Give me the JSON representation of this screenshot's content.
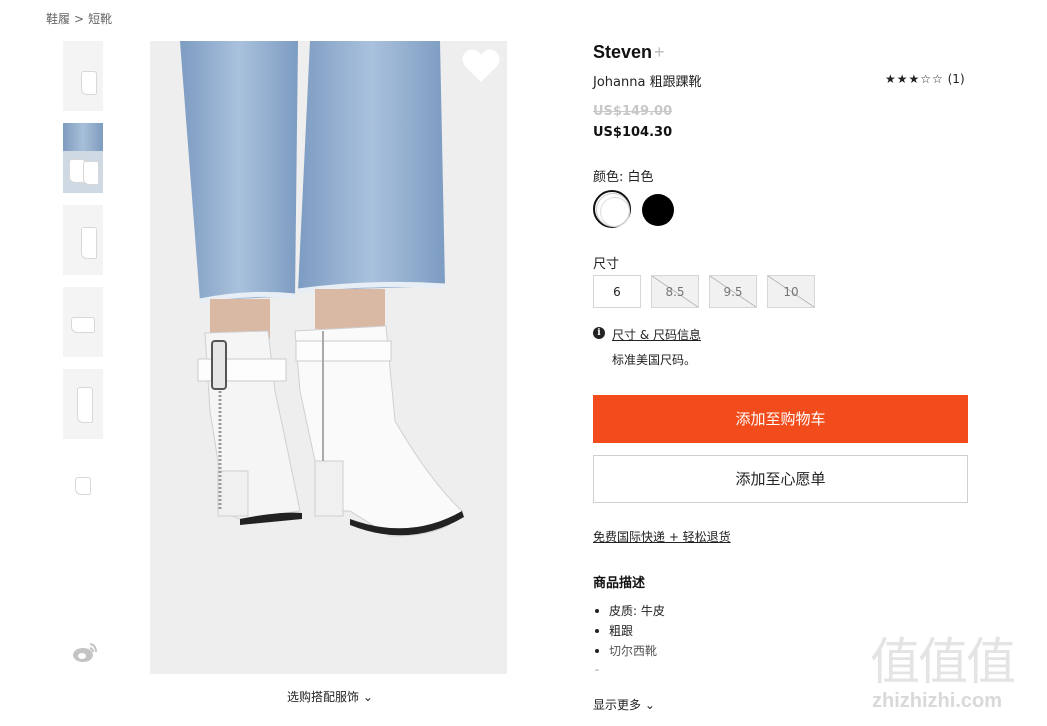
{
  "breadcrumb": {
    "level1": "鞋履",
    "sep": ">",
    "level2": "短靴"
  },
  "gallery": {
    "thumbnails": [
      "thumb-1",
      "thumb-2",
      "thumb-3",
      "thumb-4",
      "thumb-5",
      "thumb-6"
    ],
    "selected_index": 1
  },
  "main_image": {
    "match_link": "选购搭配服饰"
  },
  "product": {
    "brand": "Steven",
    "brand_plus": "+",
    "name": "Johanna 粗跟踝靴",
    "rating_stars": "★★★☆☆",
    "rating_count": "(1)",
    "price_original": "US$149.00",
    "price_sale": "US$104.30"
  },
  "color": {
    "label": "颜色: 白色",
    "options": [
      "white",
      "black"
    ],
    "selected": "white",
    "hex_white": "#ffffff",
    "hex_black": "#000000"
  },
  "size": {
    "label": "尺寸",
    "options": [
      {
        "value": "6",
        "available": true
      },
      {
        "value": "8.5",
        "available": false
      },
      {
        "value": "9.5",
        "available": false
      },
      {
        "value": "10",
        "available": false
      }
    ],
    "info_link": "尺寸 & 尺码信息",
    "note": "标准美国尺码。"
  },
  "actions": {
    "add_to_cart": "添加至购物车",
    "add_to_wishlist": "添加至心愿单",
    "accent_color": "#f24c1c"
  },
  "shipping_link": "免费国际快递 + 轻松退货",
  "description": {
    "title": "商品描述",
    "items": [
      "皮质: 牛皮",
      "粗跟",
      "切尔西靴",
      "..."
    ]
  },
  "show_more": "显示更多",
  "watermark": {
    "logo": "值值值",
    "url": "zhizhizhi.com"
  }
}
